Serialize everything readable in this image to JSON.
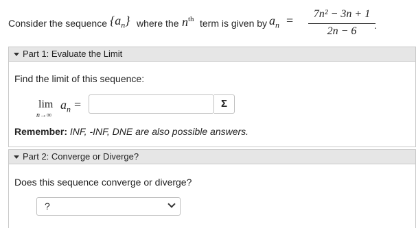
{
  "intro": {
    "before": "Consider the sequence",
    "seq_symbol": "{a",
    "seq_sub": "n",
    "seq_close": "}",
    "middle": "where the",
    "n": "n",
    "th": "th",
    "after": "term is given by",
    "an": "a",
    "an_sub": "n",
    "equals": "=",
    "numerator": "7n² − 3n + 1",
    "denominator": "2n − 6",
    "period": "."
  },
  "part1": {
    "header": "Part 1: Evaluate the Limit",
    "prompt": "Find the limit of this sequence:",
    "lim_word": "lim",
    "lim_sub": "n→∞",
    "lim_an": "a",
    "lim_an_sub": "n",
    "lim_equals": "=",
    "answer_value": "",
    "sigma_label": "Σ",
    "remember_label": "Remember:",
    "remember_text": "INF, -INF, DNE are also possible answers."
  },
  "part2": {
    "header": "Part 2: Converge or Diverge?",
    "prompt": "Does this sequence converge or diverge?",
    "select_value": "?"
  }
}
